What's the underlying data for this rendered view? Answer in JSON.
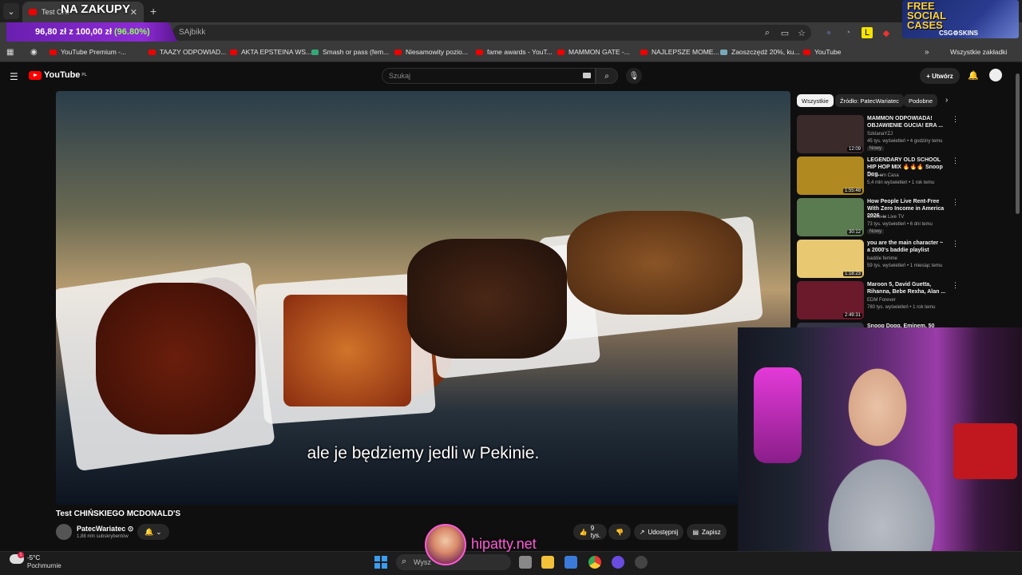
{
  "browser": {
    "active_tab_title": "Test CHI",
    "tab_overlay_text": "NA ZAKUPY",
    "address_text": "SAjbikk",
    "promo": {
      "amount": "96,80 zł z 100,00 zł",
      "percent": "(96.80%)"
    },
    "ad": {
      "title": "FREE SOCIAL CASES",
      "sub": "CSG⚙SKINS"
    },
    "bookmarks": [
      "YouTube Premium -...",
      "TAAZY ODPOWIAD...",
      "AKTA EPSTEINA WS...",
      "Smash or pass (fem...",
      "Niesamowity pozio...",
      "fame awards - YouT...",
      "MAMMON GATE -...",
      "NAJLEPSZE MOME...",
      "Zaoszczędź 20%, ku...",
      "YouTube"
    ],
    "all_bookmarks": "Wszystkie zakładki"
  },
  "youtube": {
    "logo": "YouTube",
    "region": "PL",
    "search_placeholder": "Szukaj",
    "create_label": "+ Utwórz",
    "subtitle": "ale je będziemy jedli w Pekinie.",
    "video_title": "Test CHIŃSKIEGO MCDONALD'S",
    "channel": {
      "name": "PatecWariatec ⊙",
      "subs": "1,88 mln subskrybentów"
    },
    "actions": {
      "likes": "9 tys.",
      "share": "Udostępnij",
      "save": "Zapisz"
    },
    "chips": [
      "Wszystkie",
      "Źródło: PatecWariatec",
      "Podobne"
    ],
    "recommendations": [
      {
        "title": "MAMMON ODPOWIADA! OBJAWIENIE GUCIA! ERA ...",
        "channel": "SzklanaYZJ",
        "meta": "45 tys. wyświetleń • 4 godziny temu",
        "badge": "Nowy",
        "duration": "12:09"
      },
      {
        "title": "LEGENDARY OLD SCHOOL HIP HOP MIX 🔥🔥🔥 Snoop Dog...",
        "channel": "Deus em Casa",
        "meta": "5,4 mln wyświetleń • 1 rok temu",
        "badge": "",
        "duration": "1:55:48"
      },
      {
        "title": "How People Live Rent-Free With Zero Income in America 2026 ...",
        "channel": "Where to Live TV",
        "meta": "73 tys. wyświetleń • 6 dni temu",
        "badge": "Nowy",
        "duration": "30:12"
      },
      {
        "title": "you are the main character ~ a 2000's baddie playlist",
        "channel": "baddie femme",
        "meta": "59 tys. wyświetleń • 1 miesiąc temu",
        "badge": "",
        "duration": "1:18:23"
      },
      {
        "title": "Maroon 5, David Guetta, Rihanna, Bebe Rexha, Alan ...",
        "channel": "EDM Forever",
        "meta": "780 tys. wyświetleń • 1 rok temu",
        "badge": "",
        "duration": "2:49:31"
      },
      {
        "title": "Snoop Dogg, Eminem, 50 Cent",
        "channel": "",
        "meta": "",
        "badge": "",
        "duration": ""
      }
    ],
    "rec_thumb_colors": [
      "#3a2a2a",
      "#b08a20",
      "#5a7a50",
      "#e8c870",
      "#6a1a2a",
      "#334"
    ]
  },
  "streamer": {
    "name": "hipatty.net"
  },
  "taskbar": {
    "temp": "-5°C",
    "condition": "Pochmurnie",
    "search_placeholder": "Wysz",
    "weather_badge": "1"
  }
}
